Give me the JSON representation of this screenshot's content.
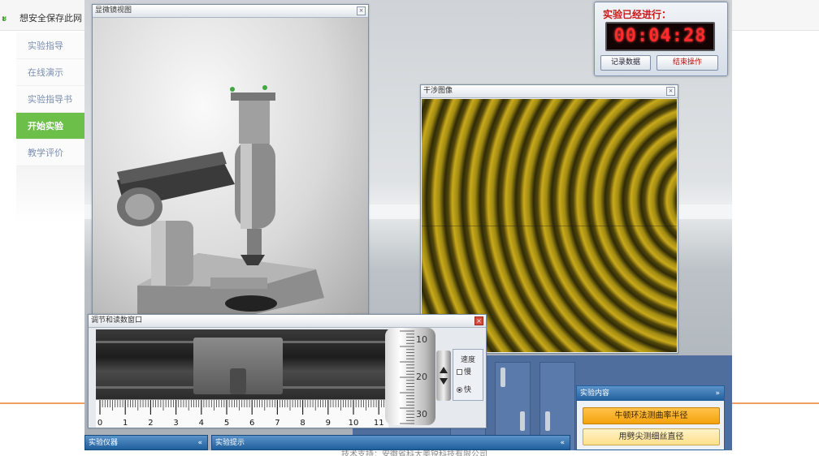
{
  "page": {
    "logo_glyph": "ะ",
    "save_tip": "想安全保存此网",
    "nav_items": [
      "实验指导",
      "在线演示",
      "实验指导书",
      "开始实验",
      "教学评价"
    ],
    "active_nav_index": 3,
    "footer_text": "技术支持：安徽省科大奥锐科技有限公司"
  },
  "microscope_window": {
    "title": "显微镜视图",
    "close_glyph": "×"
  },
  "interference_window": {
    "title": "干涉图像",
    "close_glyph": "×",
    "fringe_color": "#c9a91b"
  },
  "timer": {
    "label": "实验已经进行：",
    "time": "00:04:28",
    "record_button": "记录数据",
    "end_button": "结束操作"
  },
  "adjust_window": {
    "title": "调节和读数窗口",
    "close_glyph": "×",
    "scale_numbers": [
      "0",
      "1",
      "2",
      "3",
      "4",
      "5",
      "6",
      "7",
      "8",
      "9",
      "10",
      "11"
    ],
    "drum_numbers": [
      "10",
      "20",
      "30"
    ],
    "speed_label": "速度",
    "slow_label": "慢",
    "fast_label": "快",
    "fast_selected": true
  },
  "bottom_bars": {
    "instruments": "实验仪器",
    "tips": "实验提示",
    "chevron": "«"
  },
  "content_panel": {
    "title": "实验内容",
    "chevron": "»",
    "items": [
      "牛顿环法测曲率半径",
      "用劈尖测细丝直径"
    ]
  },
  "colors": {
    "nav_active": "#6cc04a",
    "timer_digits": "#ff2a2a",
    "panel_blue": "#1f5f9c",
    "highlight_orange": "#f3a20d"
  }
}
